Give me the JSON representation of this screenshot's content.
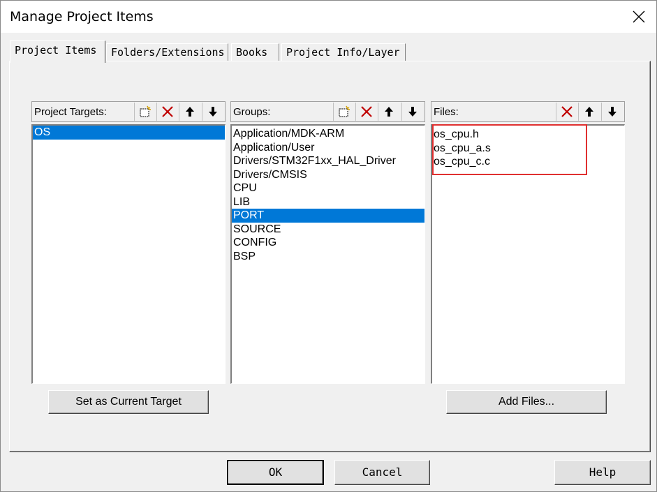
{
  "window": {
    "title": "Manage Project Items"
  },
  "tabs": [
    {
      "label": "Project Items",
      "active": true
    },
    {
      "label": "Folders/Extensions",
      "active": false
    },
    {
      "label": "Books",
      "active": false
    },
    {
      "label": "Project Info/Layer",
      "active": false
    }
  ],
  "targets": {
    "label": "Project Targets:",
    "items": [
      "OS"
    ],
    "selected": "OS"
  },
  "groups": {
    "label": "Groups:",
    "items": [
      "Application/MDK-ARM",
      "Application/User",
      "Drivers/STM32F1xx_HAL_Driver",
      "Drivers/CMSIS",
      "CPU",
      "LIB",
      "PORT",
      "SOURCE",
      "CONFIG",
      "BSP"
    ],
    "selected": "PORT"
  },
  "files": {
    "label": "Files:",
    "items": [
      "os_cpu.h",
      "os_cpu_a.s",
      "os_cpu_c.c"
    ],
    "highlight_color": "#e03030"
  },
  "buttons": {
    "set_target": "Set as Current Target",
    "add_files": "Add Files...",
    "ok": "OK",
    "cancel": "Cancel",
    "help": "Help"
  },
  "colors": {
    "selection": "#0078d7",
    "delete_icon": "#c00000"
  },
  "icons": [
    "new-icon",
    "delete-icon",
    "move-up-icon",
    "move-down-icon",
    "close-icon"
  ]
}
